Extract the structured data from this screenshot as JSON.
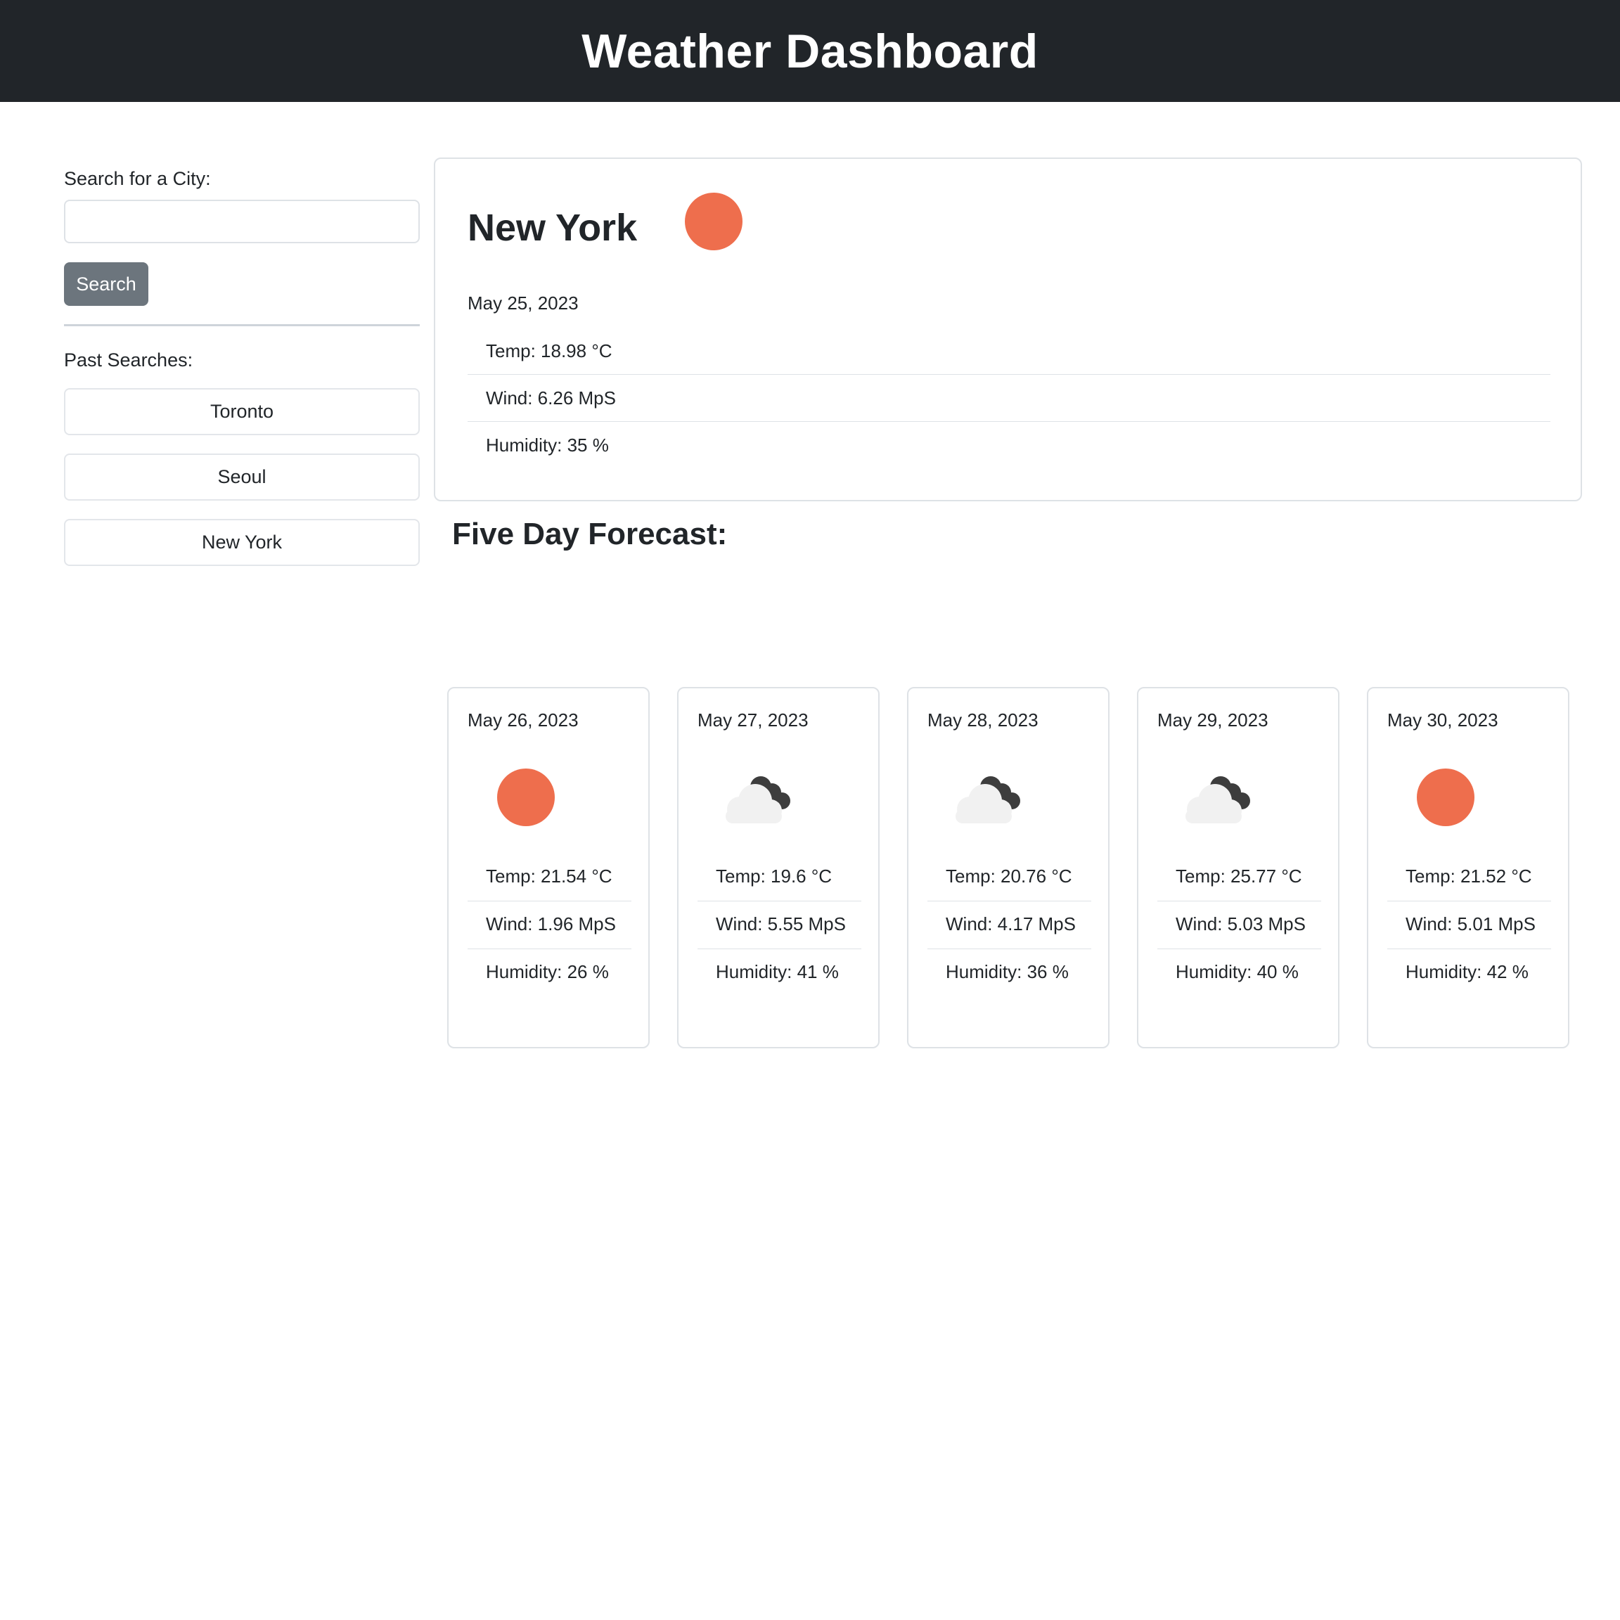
{
  "header": {
    "title": "Weather Dashboard"
  },
  "sidebar": {
    "search_label": "Search for a City:",
    "search_value": "",
    "search_button": "Search",
    "past_label": "Past Searches:",
    "history": [
      "Toronto",
      "Seoul",
      "New York"
    ]
  },
  "current": {
    "city": "New York",
    "icon": "sun-icon",
    "date": "May 25, 2023",
    "temp": "Temp: 18.98 °C",
    "wind": "Wind: 6.26 MpS",
    "humidity": "Humidity: 35 %"
  },
  "forecast": {
    "title": "Five Day Forecast:",
    "days": [
      {
        "date": "May 26, 2023",
        "icon": "sun-icon",
        "temp": "Temp: 21.54 °C",
        "wind": "Wind: 1.96 MpS",
        "humidity": "Humidity: 26 %"
      },
      {
        "date": "May 27, 2023",
        "icon": "cloud-icon",
        "temp": "Temp: 19.6 °C",
        "wind": "Wind: 5.55 MpS",
        "humidity": "Humidity: 41 %"
      },
      {
        "date": "May 28, 2023",
        "icon": "cloud-icon",
        "temp": "Temp: 20.76 °C",
        "wind": "Wind: 4.17 MpS",
        "humidity": "Humidity: 36 %"
      },
      {
        "date": "May 29, 2023",
        "icon": "cloud-icon",
        "temp": "Temp: 25.77 °C",
        "wind": "Wind: 5.03 MpS",
        "humidity": "Humidity: 40 %"
      },
      {
        "date": "May 30, 2023",
        "icon": "sun-icon",
        "temp": "Temp: 21.52 °C",
        "wind": "Wind: 5.01 MpS",
        "humidity": "Humidity: 42 %"
      }
    ]
  },
  "colors": {
    "header_bg": "#212529",
    "sun": "#ee6e4d",
    "cloud_light": "#f1f1f1",
    "cloud_dark": "#3d3d3d",
    "button_bg": "#6c757d"
  }
}
